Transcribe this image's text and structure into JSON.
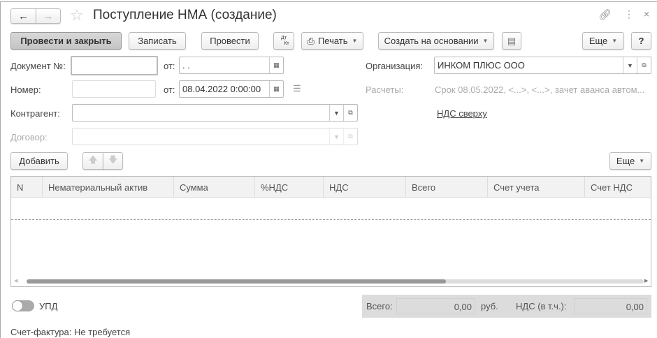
{
  "title": "Поступление НМА (создание)",
  "toolbar": {
    "post_close": "Провести и закрыть",
    "save": "Записать",
    "post": "Провести",
    "dtkt_top": "Дт",
    "dtkt_bottom": "Кт",
    "print": "Печать",
    "create_based": "Создать на основании",
    "more": "Еще",
    "help": "?"
  },
  "form": {
    "doc_no_label": "Документ №:",
    "doc_no_value": "",
    "from_label": "от:",
    "doc_date_value": " .  .",
    "number_label": "Номер:",
    "number_value": "",
    "date_value": "08.04.2022  0:00:00",
    "org_label": "Организация:",
    "org_value": "ИНКОМ ПЛЮС ООО",
    "settlements_label": "Расчеты:",
    "settlements_value": "Срок 08.05.2022, <...>, <...>, зачет аванса автом...",
    "contractor_label": "Контрагент:",
    "contractor_value": "",
    "vat_link": "НДС сверху",
    "contract_label": "Договор:",
    "contract_value": ""
  },
  "table_toolbar": {
    "add": "Добавить",
    "more": "Еще"
  },
  "table": {
    "columns": [
      "N",
      "Нематериальный актив",
      "Сумма",
      "%НДС",
      "НДС",
      "Всего",
      "Счет учета",
      "Счет НДС"
    ],
    "rows": []
  },
  "footer": {
    "upd_label": "УПД",
    "total_label": "Всего:",
    "total_value": "0,00",
    "currency": "руб.",
    "vat_label": "НДС (в т.ч.):",
    "vat_value": "0,00",
    "invoice_text": "Счет-фактура: Не требуется"
  }
}
